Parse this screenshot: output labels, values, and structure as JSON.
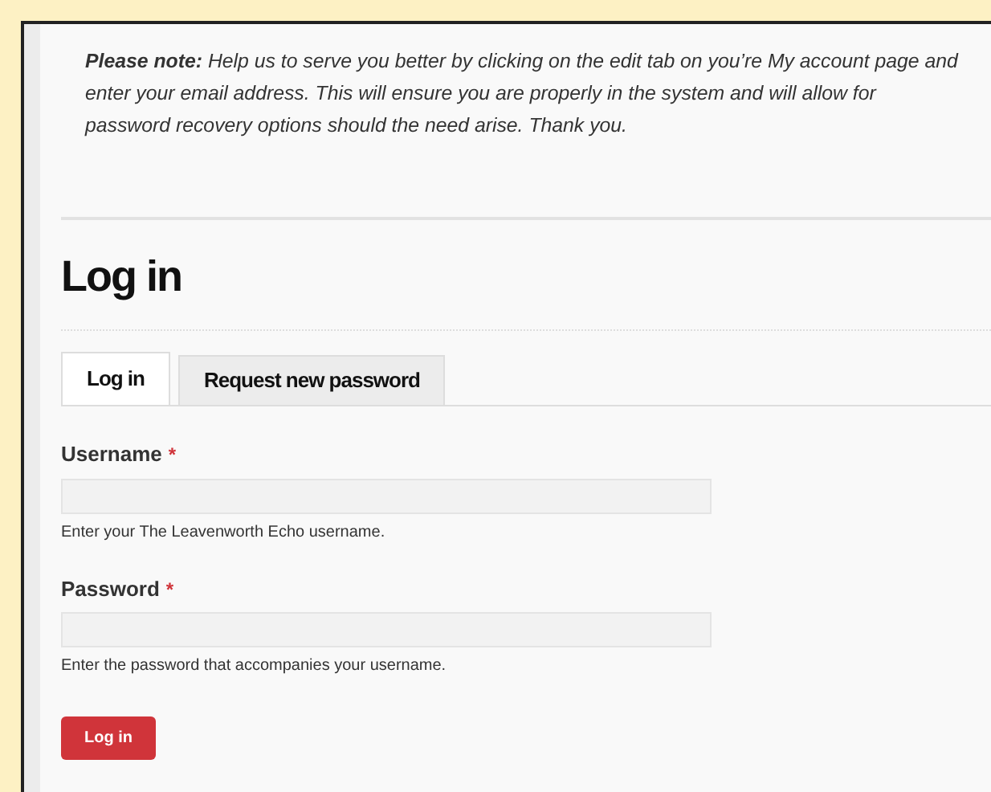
{
  "note": {
    "text": "**Please note:** Help us to serve you better by clicking on the edit tab on you’re My account page and enter your email address. This will ensure you are properly in the system and will allow for password recovery options should the need arise. Thank you."
  },
  "heading": "Log in",
  "tabs": [
    {
      "label": "Log in",
      "selected": true
    },
    {
      "label": "Request new password",
      "selected": false
    }
  ],
  "fields": [
    {
      "label": "Username",
      "required_mark": "*",
      "help": "Enter your The Leavenworth Echo username."
    },
    {
      "label": "Password",
      "required_mark": "*",
      "help": "Enter the password that accompanies your username."
    }
  ],
  "submit": {
    "label": "Log in"
  }
}
